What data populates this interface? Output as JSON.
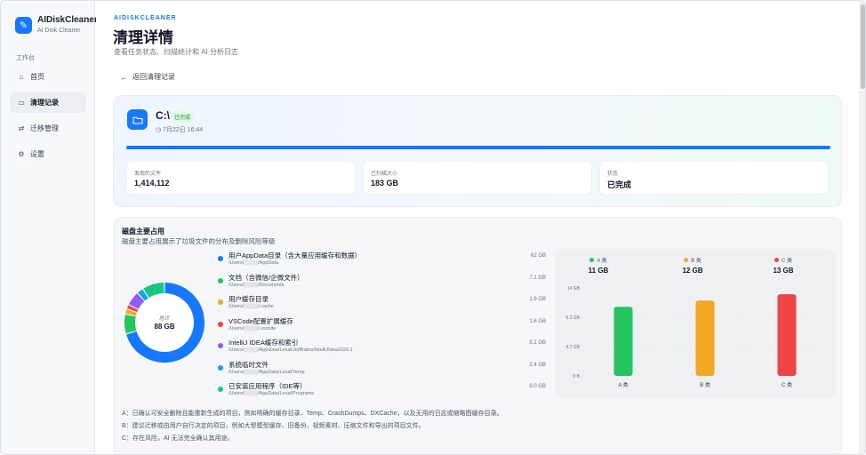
{
  "app": {
    "name": "AIDiskCleaner",
    "subtitle": "AI Disk Cleaner"
  },
  "sidebar": {
    "section_label": "工作台",
    "items": [
      {
        "label": "首页",
        "icon": "home-icon",
        "glyph": "⌂",
        "active": false
      },
      {
        "label": "清理记录",
        "icon": "drive-icon",
        "glyph": "▭",
        "active": true
      },
      {
        "label": "迁移管理",
        "icon": "migrate-icon",
        "glyph": "⇄",
        "active": false
      },
      {
        "label": "设置",
        "icon": "gear-icon",
        "glyph": "⚙",
        "active": false
      }
    ]
  },
  "header": {
    "eyebrow": "AIDISKCLEANER",
    "title": "清理详情",
    "subtitle": "查看任务状态、扫描统计和 AI 分析日志",
    "back_label": "返回清理记录"
  },
  "summary": {
    "drive": "C:\\",
    "status_chip": "已完成",
    "date": "7月22日 16:44",
    "progress": 1.0,
    "stats": [
      {
        "label": "发现的文件",
        "value": "1,414,112"
      },
      {
        "label": "已扫描大小",
        "value": "183 GB"
      },
      {
        "label": "状态",
        "value": "已完成"
      }
    ]
  },
  "usage": {
    "title": "磁盘主要占用",
    "subtitle": "磁盘主要占用展示了垃圾文件的分布及删除风险等级",
    "total_label": "总计",
    "total_value": "88 GB",
    "items": [
      {
        "name": "用户AppData目录（含大量应用缓存和数据）",
        "path": "/Users/░░░░/AppData",
        "size": "62 GB",
        "gb": 62,
        "color": "#1677ff"
      },
      {
        "name": "文档（含微信/企微文件）",
        "path": "/Users/░░░░/Documents",
        "size": "7.1 GB",
        "gb": 7.1,
        "color": "#22c55e"
      },
      {
        "name": "用户缓存目录",
        "path": "/Users/░░░░/.cache",
        "size": "1.9 GB",
        "gb": 1.9,
        "color": "#f5a623"
      },
      {
        "name": "VSCode配置扩展缓存",
        "path": "/Users/░░░░/.vscode",
        "size": "1.6 GB",
        "gb": 1.6,
        "color": "#ef4444"
      },
      {
        "name": "IntelliJ IDEA缓存和索引",
        "path": "/Users/░░░░/AppData/Local/JetBrains/IntelliJIdea2026.1",
        "size": "5.1 GB",
        "gb": 5.1,
        "color": "#8b5cf6"
      },
      {
        "name": "系统临时文件",
        "path": "/Users/░░░░/AppData/Local/Temp",
        "size": "2.4 GB",
        "gb": 2.4,
        "color": "#0ea5e9"
      },
      {
        "name": "已安装应用程序（IDE等）",
        "path": "/Users/░░░░/AppData/Local/Programs",
        "size": "8.0 GB",
        "gb": 8.0,
        "color": "#16c784"
      }
    ],
    "notes": [
      "A：已确认可安全删除且能重新生成的项目，例如明确的缓存目录、Temp、CrashDumps、DXCache，以及无用的日志或缩略图缓存目录。",
      "B：建议迁移或由用户自行决定的项目，例如大型模型缓存、旧备份、视频素材、压缩文件和导出的项目文件。",
      "C：存在风险，AI 无法完全确认其用途。"
    ]
  },
  "chart_data": {
    "type": "bar",
    "categories": [
      "A 类",
      "B 类",
      "C 类"
    ],
    "values": [
      11,
      12,
      13
    ],
    "value_labels": [
      "11 GB",
      "12 GB",
      "13 GB"
    ],
    "colors": [
      "#22c55e",
      "#f5a623",
      "#ef4444"
    ],
    "yticks": [
      "14 GB",
      "9.3 GB",
      "4.7 GB",
      "0 B"
    ],
    "ylim": [
      0,
      14
    ],
    "grid": true
  }
}
